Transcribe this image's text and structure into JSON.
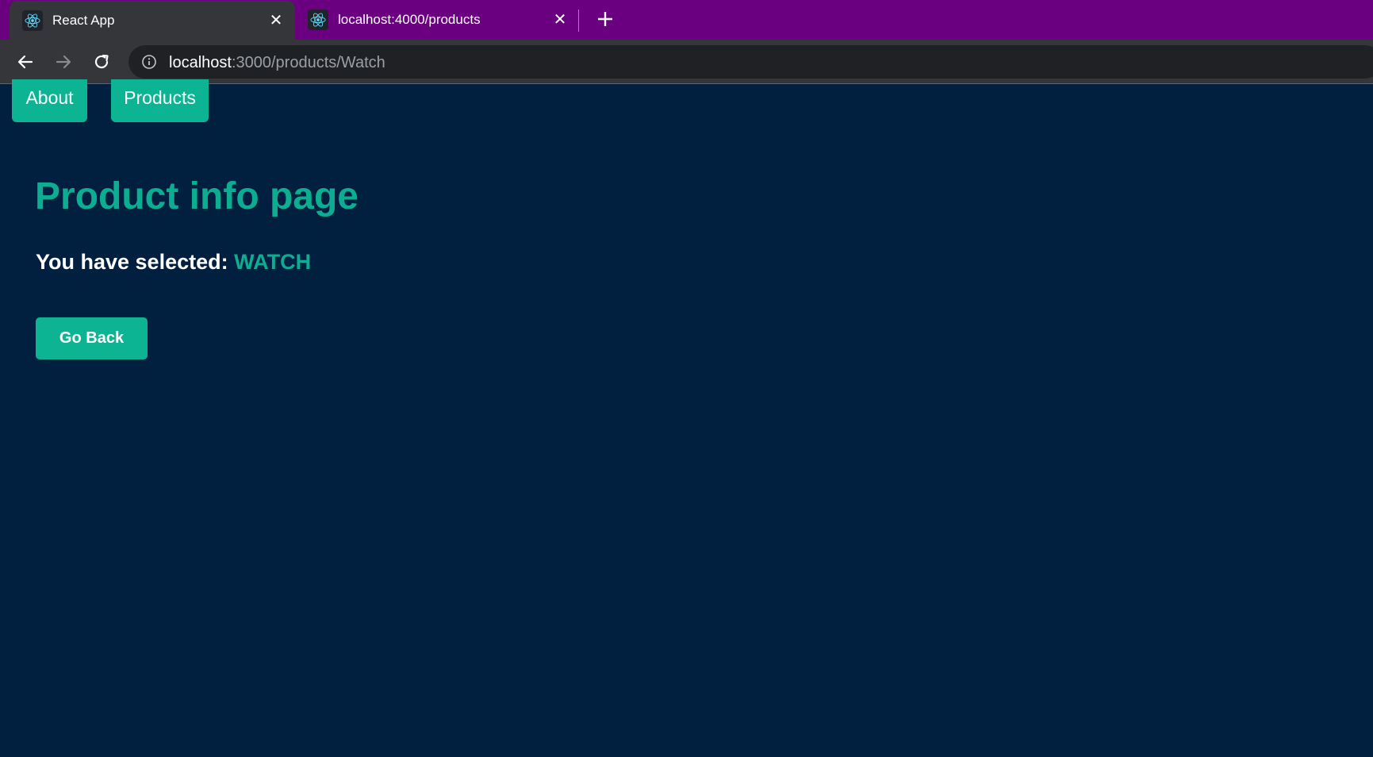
{
  "browser": {
    "tabs": [
      {
        "title": "React App",
        "active": true,
        "favicon": "react-icon"
      },
      {
        "title": "localhost:4000/products",
        "active": false,
        "favicon": "react-icon"
      }
    ],
    "new_tab_icon": "plus-icon",
    "close_icon": "close-icon",
    "address": {
      "host": "localhost",
      "rest": ":3000/products/Watch"
    }
  },
  "nav": {
    "about_label": "About",
    "products_label": "Products"
  },
  "main": {
    "title": "Product info page",
    "selected_prefix": "You have selected: ",
    "selected_product": "WATCH",
    "go_back_label": "Go Back"
  },
  "colors": {
    "background": "#012040",
    "accent": "#0cb494",
    "tabstrip": "#6a0080",
    "toolbar": "#35363a"
  }
}
